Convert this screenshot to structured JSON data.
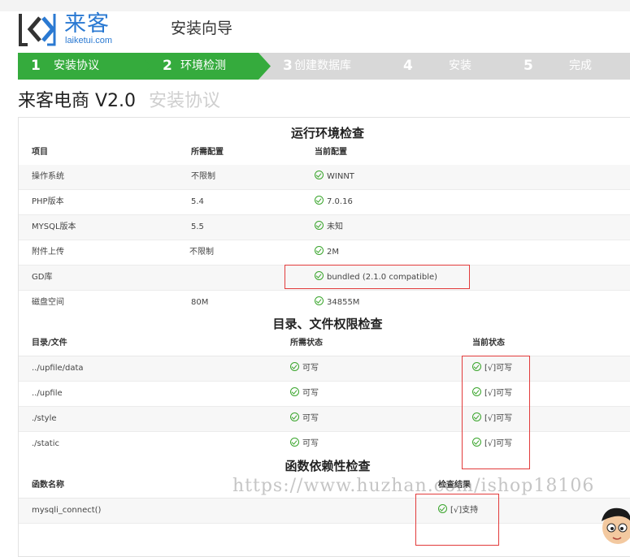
{
  "brand": {
    "name_cn": "来客",
    "name_en": "laiketui.com"
  },
  "header": {
    "title": "安装向导"
  },
  "steps": [
    {
      "num": "1",
      "label": "安装协议",
      "active": true
    },
    {
      "num": "2",
      "label": "环境检测",
      "active": true
    },
    {
      "num": "3",
      "label": "创建数据库",
      "active": false
    },
    {
      "num": "4",
      "label": "安装",
      "active": false
    },
    {
      "num": "5",
      "label": "完成",
      "active": false
    }
  ],
  "page": {
    "title": "来客电商 V2.0",
    "subtitle": "安装协议"
  },
  "env": {
    "title": "运行环境检查",
    "headers": [
      "项目",
      "所需配置",
      "当前配置"
    ],
    "rows": [
      {
        "item": "操作系统",
        "required": "不限制",
        "current": "WINNT"
      },
      {
        "item": "PHP版本",
        "required": "5.4",
        "current": "7.0.16"
      },
      {
        "item": "MYSQL版本",
        "required": "5.5",
        "current": "未知"
      },
      {
        "item": "附件上传",
        "required": "不限制",
        "current": "2M"
      },
      {
        "item": "GD库",
        "required": "",
        "current": "bundled (2.1.0 compatible)"
      },
      {
        "item": "磁盘空间",
        "required": "80M",
        "current": "34855M"
      }
    ]
  },
  "perm": {
    "title": "目录、文件权限检查",
    "headers": [
      "目录/文件",
      "所需状态",
      "当前状态"
    ],
    "rows": [
      {
        "path": "../upfile/data",
        "required": "可写",
        "current": "[√]可写"
      },
      {
        "path": "../upfile",
        "required": "可写",
        "current": "[√]可写"
      },
      {
        "path": "./style",
        "required": "可写",
        "current": "[√]可写"
      },
      {
        "path": "./static",
        "required": "可写",
        "current": "[√]可写"
      }
    ]
  },
  "func": {
    "title": "函数依赖性检查",
    "headers": [
      "函数名称",
      "检查结果"
    ],
    "rows": [
      {
        "name": "mysqli_connect()",
        "result": "[√]支持"
      }
    ]
  },
  "watermark": "https://www.huzhan.com/ishop18106",
  "colors": {
    "step_active": "#35ab3d",
    "step_inactive": "#d8d8d8",
    "brand": "#2a79d2",
    "highlight": "#e23b3b",
    "ok": "#3aa52c"
  }
}
